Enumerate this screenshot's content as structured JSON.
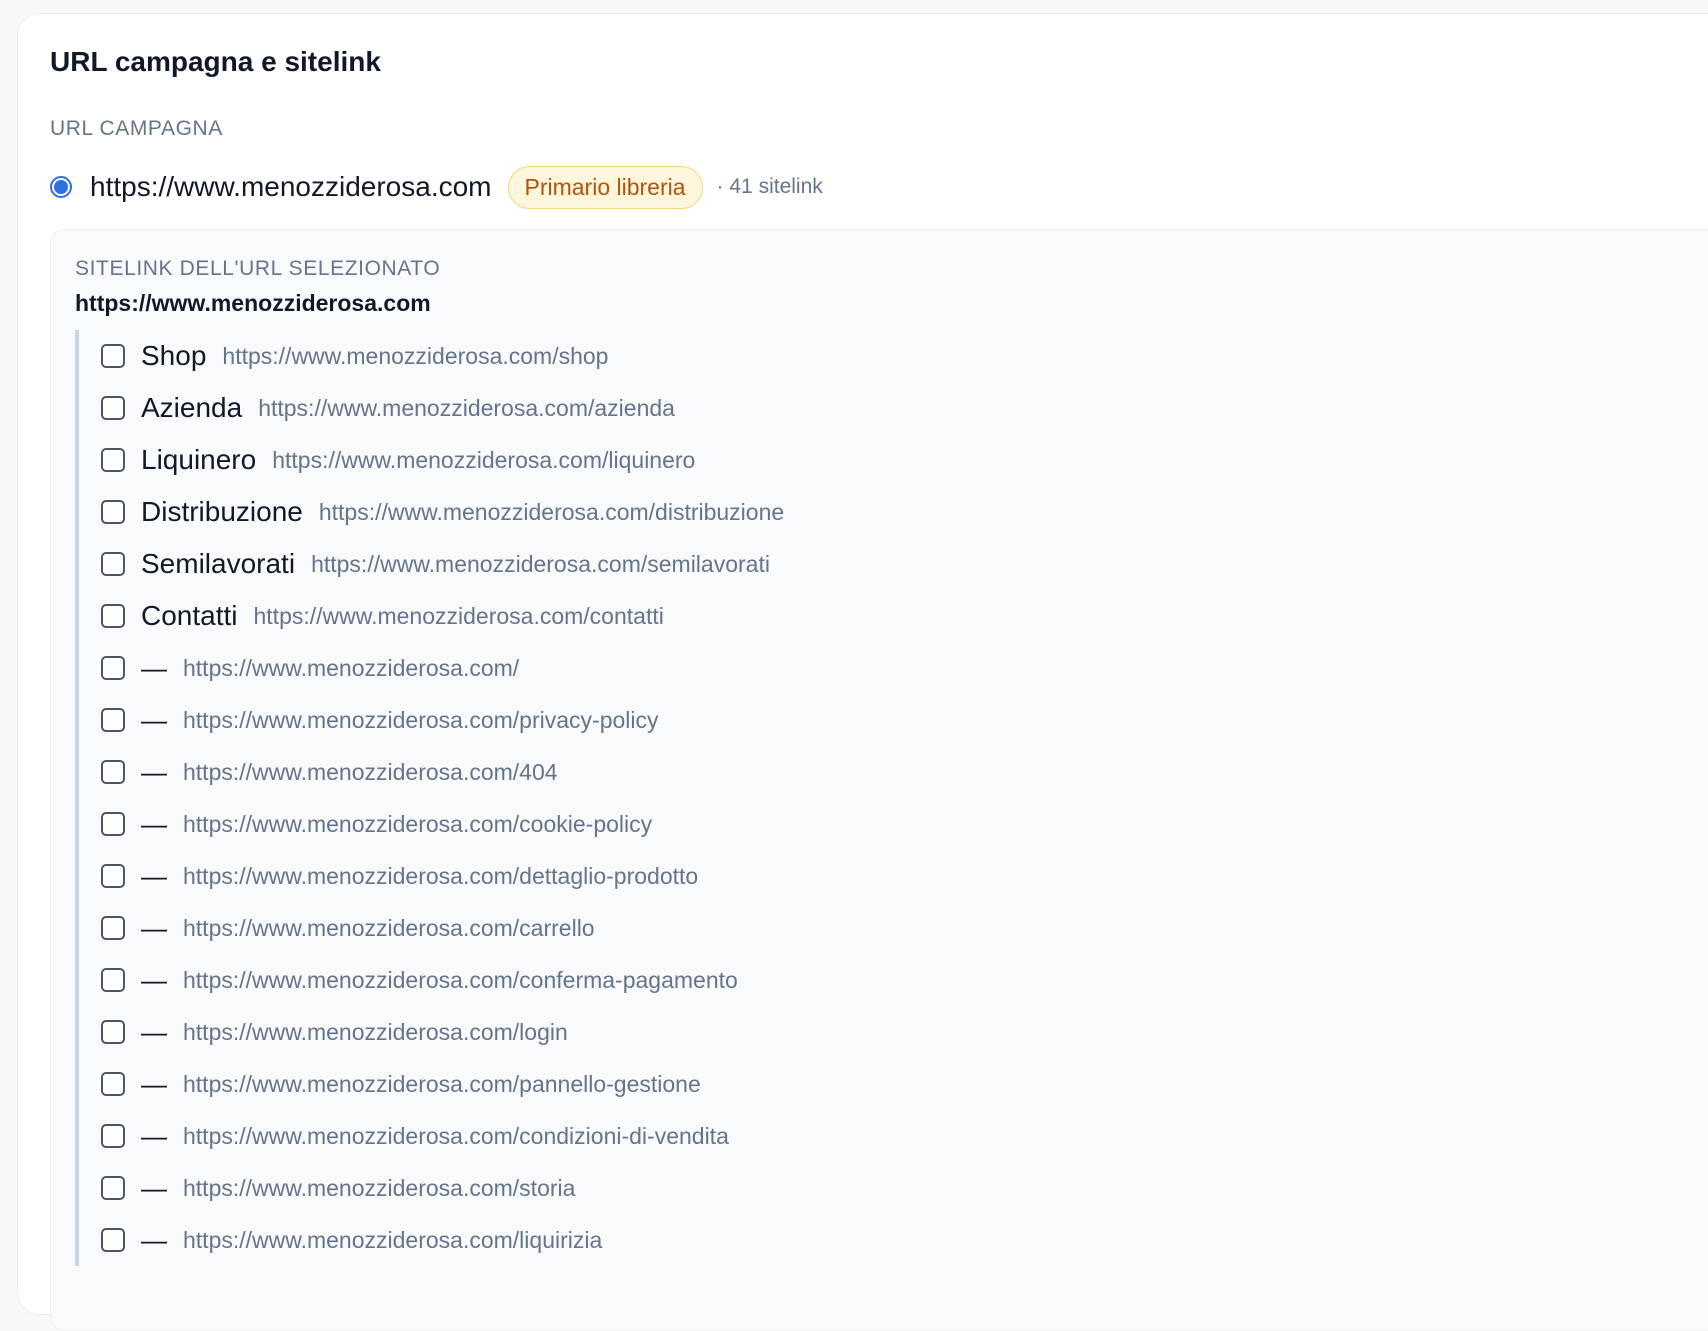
{
  "card": {
    "title": "URL campagna e sitelink"
  },
  "campaign": {
    "section_label": "URL CAMPAGNA",
    "selected_url": "https://www.menozziderosa.com",
    "badge": "Primario libreria",
    "sitelink_count": "· 41 sitelink"
  },
  "panel": {
    "label": "SITELINK DELL'URL SELEZIONATO",
    "url": "https://www.menozziderosa.com",
    "items": [
      {
        "label": "Shop",
        "url": "https://www.menozziderosa.com/shop",
        "checked": false
      },
      {
        "label": "Azienda",
        "url": "https://www.menozziderosa.com/azienda",
        "checked": false
      },
      {
        "label": "Liquinero",
        "url": "https://www.menozziderosa.com/liquinero",
        "checked": false
      },
      {
        "label": "Distribuzione",
        "url": "https://www.menozziderosa.com/distribuzione",
        "checked": false
      },
      {
        "label": "Semilavorati",
        "url": "https://www.menozziderosa.com/semilavorati",
        "checked": false
      },
      {
        "label": "Contatti",
        "url": "https://www.menozziderosa.com/contatti",
        "checked": false
      },
      {
        "label": "—",
        "url": "https://www.menozziderosa.com/",
        "checked": false
      },
      {
        "label": "—",
        "url": "https://www.menozziderosa.com/privacy-policy",
        "checked": false
      },
      {
        "label": "—",
        "url": "https://www.menozziderosa.com/404",
        "checked": false
      },
      {
        "label": "—",
        "url": "https://www.menozziderosa.com/cookie-policy",
        "checked": false
      },
      {
        "label": "—",
        "url": "https://www.menozziderosa.com/dettaglio-prodotto",
        "checked": false
      },
      {
        "label": "—",
        "url": "https://www.menozziderosa.com/carrello",
        "checked": false
      },
      {
        "label": "—",
        "url": "https://www.menozziderosa.com/conferma-pagamento",
        "checked": false
      },
      {
        "label": "—",
        "url": "https://www.menozziderosa.com/login",
        "checked": false
      },
      {
        "label": "—",
        "url": "https://www.menozziderosa.com/pannello-gestione",
        "checked": false
      },
      {
        "label": "—",
        "url": "https://www.menozziderosa.com/condizioni-di-vendita",
        "checked": false
      },
      {
        "label": "—",
        "url": "https://www.menozziderosa.com/storia",
        "checked": false
      },
      {
        "label": "—",
        "url": "https://www.menozziderosa.com/liquirizia",
        "checked": false
      }
    ]
  },
  "colors": {
    "accent": "#2f6fe4",
    "badge_text": "#b45309",
    "badge_bg": "#fef6dc",
    "muted_text": "#64748b"
  }
}
